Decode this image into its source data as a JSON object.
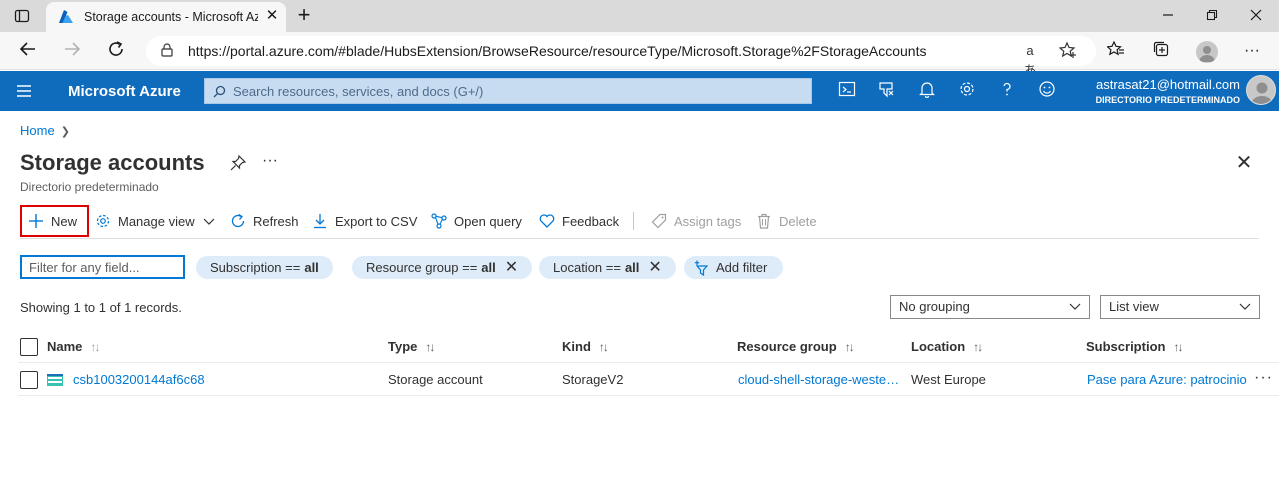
{
  "browser": {
    "tab_title": "Storage accounts - Microsoft Azure",
    "tab_close": "✕",
    "new_tab": "+",
    "url": "https://portal.azure.com/#blade/HubsExtension/BrowseResource/resourceType/Microsoft.Storage%2FStorageAccounts",
    "read_aloud": "aあ",
    "more": "···"
  },
  "azure": {
    "brand": "Microsoft Azure",
    "search_placeholder": "Search resources, services, and docs (G+/)",
    "account_email": "astrasat21@hotmail.com",
    "account_directory": "DIRECTORIO PREDETERMINADO",
    "accent": "#0f6cbd"
  },
  "page": {
    "breadcrumb_home": "Home",
    "title": "Storage accounts",
    "subtitle": "Directorio predeterminado",
    "title_more": "···",
    "close": "✕"
  },
  "commands": {
    "new": "New",
    "manage_view": "Manage view",
    "refresh": "Refresh",
    "export_csv": "Export to CSV",
    "open_query": "Open query",
    "feedback": "Feedback",
    "assign_tags": "Assign tags",
    "delete": "Delete"
  },
  "filters": {
    "placeholder": "Filter for any field...",
    "subscription_label": "Subscription ==",
    "subscription_value": "all",
    "resource_group_label": "Resource group ==",
    "resource_group_value": "all",
    "location_label": "Location ==",
    "location_value": "all",
    "add_filter": "Add filter",
    "remove": "✕"
  },
  "summary": {
    "records": "Showing 1 to 1 of 1 records.",
    "grouping": "No grouping",
    "view": "List view"
  },
  "table": {
    "columns": [
      "Name",
      "Type",
      "Kind",
      "Resource group",
      "Location",
      "Subscription"
    ],
    "sort_glyph": "↑↓",
    "rows": [
      {
        "name": "csb1003200144af6c68",
        "type": "Storage account",
        "kind": "StorageV2",
        "resource_group": "cloud-shell-storage-weste…",
        "location": "West Europe",
        "subscription": "Pase para Azure: patrocinio"
      }
    ],
    "row_more": "···"
  }
}
